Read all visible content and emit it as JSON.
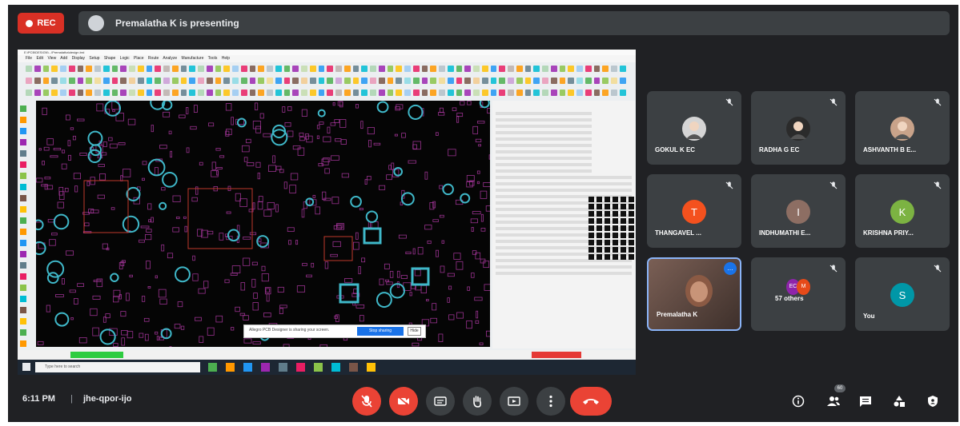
{
  "top": {
    "rec_label": "REC",
    "presenting_text": "Premalatha K is presenting"
  },
  "screen": {
    "window_title": "E:\\PCB\\DESIGN\\...\\Premalatha\\design.brd",
    "menu": "File Edit View Add Display Setup Shape Logic Place Route Analyze Manufacture Tools Help",
    "taskbar_search": "Type here to search",
    "popup_text": "Allegro PCB Designer is sharing your screen.",
    "popup_button": "Stop sharing",
    "popup_hide": "Hide"
  },
  "tiles": [
    {
      "name": "GOKUL K EC",
      "avatar": "photo",
      "avatar_color": "#d5d5d5"
    },
    {
      "name": "RADHA G EC",
      "avatar": "photo",
      "avatar_color": "#2b2b2b"
    },
    {
      "name": "ASHVANTH B E...",
      "avatar": "photo",
      "avatar_color": "#c9a38a"
    },
    {
      "name": "THANGAVEL ...",
      "avatar": "T",
      "avatar_color": "#f4511e"
    },
    {
      "name": "INDHUMATHI E...",
      "avatar": "I",
      "avatar_color": "#8d6e63"
    },
    {
      "name": "KRISHNA PRIY...",
      "avatar": "K",
      "avatar_color": "#7cb342"
    },
    {
      "name": "Premalatha K",
      "avatar": "video",
      "avatar_color": "#5a4a44"
    },
    {
      "name": "57 others",
      "avatar": "EC M",
      "avatar_color": "#8e24aa"
    },
    {
      "name": "You",
      "avatar": "S",
      "avatar_color": "#0097a7"
    }
  ],
  "bottom": {
    "time": "6:11 PM",
    "separator": "|",
    "meeting_code": "jhe-qpor-ijo",
    "participants_count": "60"
  },
  "colors": {
    "meet_bg": "#202124",
    "tile_bg": "#3c4043",
    "red": "#ea4335",
    "pcb_bg": "#050505",
    "pcb_magenta": "#b23aa6",
    "pcb_cyan": "#3fb8c9"
  }
}
